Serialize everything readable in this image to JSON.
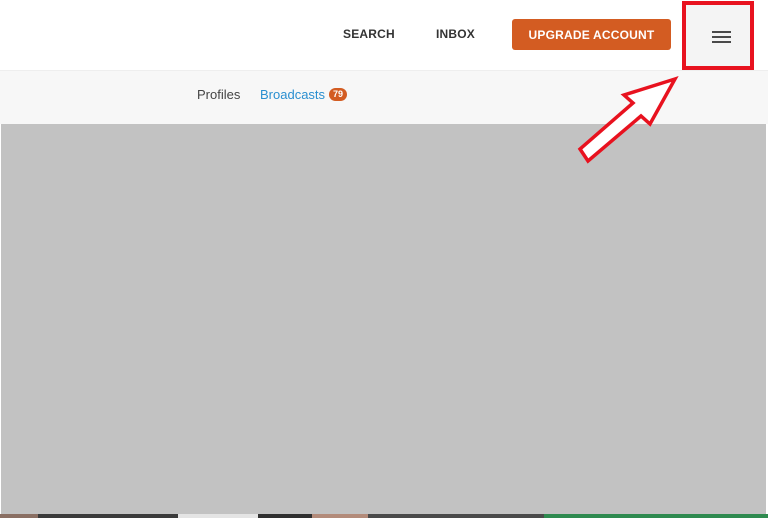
{
  "header": {
    "search_label": "SEARCH",
    "inbox_label": "INBOX",
    "upgrade_label": "UPGRADE ACCOUNT",
    "menu_icon": "hamburger-menu-icon"
  },
  "tabs": {
    "profiles_label": "Profiles",
    "broadcasts_label": "Broadcasts",
    "broadcasts_count": "79"
  },
  "annotation": {
    "color": "#e8121f",
    "shape": "arrow pointing to highlighted menu button"
  },
  "colors": {
    "accent": "#d35c22",
    "link": "#2a8fd0",
    "media_placeholder": "#c2c2c2"
  }
}
